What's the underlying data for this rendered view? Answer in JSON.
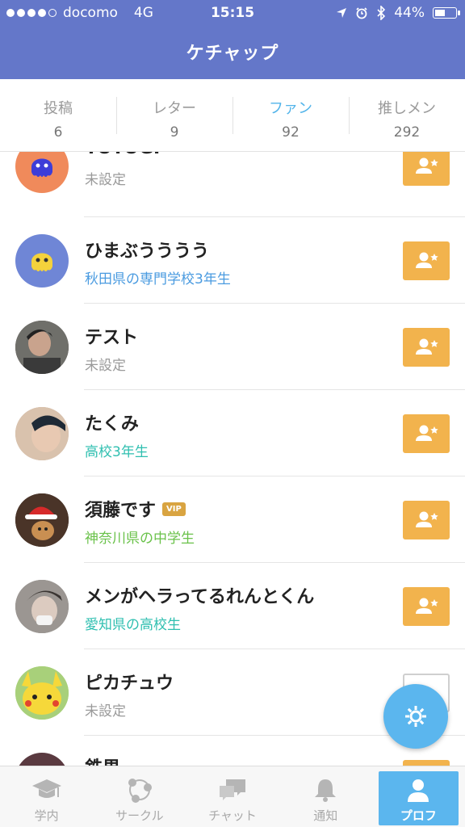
{
  "status": {
    "carrier": "docomo",
    "network": "4G",
    "time": "15:15",
    "battery": "44%",
    "battery_level": 0.44
  },
  "header": {
    "title": "ケチャップ"
  },
  "stats": [
    {
      "label": "投稿",
      "value": "6"
    },
    {
      "label": "レター",
      "value": "9"
    },
    {
      "label": "ファン",
      "value": "92"
    },
    {
      "label": "推しメン",
      "value": "292"
    }
  ],
  "users": [
    {
      "name": "YOYOGI",
      "sub": "未設定"
    },
    {
      "name": "ひまぶうううう",
      "sub": "秋田県の専門学校3年生"
    },
    {
      "name": "テスト",
      "sub": "未設定"
    },
    {
      "name": "たくみ",
      "sub": "高校3年生"
    },
    {
      "name": "須藤です",
      "badge": "VIP",
      "sub": "神奈川県の中学生"
    },
    {
      "name": "メンがヘラってるれんとくん",
      "sub": "愛知県の高校生"
    },
    {
      "name": "ピカチュウ",
      "sub": "未設定"
    },
    {
      "name": "鉄男",
      "sub": ""
    }
  ],
  "tabs": [
    {
      "label": "学内",
      "icon": "graduation-cap-icon"
    },
    {
      "label": "サークル",
      "icon": "circle-network-icon"
    },
    {
      "label": "チャット",
      "icon": "chat-bubbles-icon"
    },
    {
      "label": "通知",
      "icon": "bell-icon"
    },
    {
      "label": "プロフ",
      "icon": "person-icon"
    }
  ],
  "colors": {
    "header": "#6477c9",
    "accent": "#52b4ea",
    "fan_button": "#f2b34d",
    "sub_grey": "#9a9a9a",
    "sub_blue": "#4a9be0",
    "sub_teal": "#2fbfb0",
    "sub_green": "#6ac24a"
  }
}
